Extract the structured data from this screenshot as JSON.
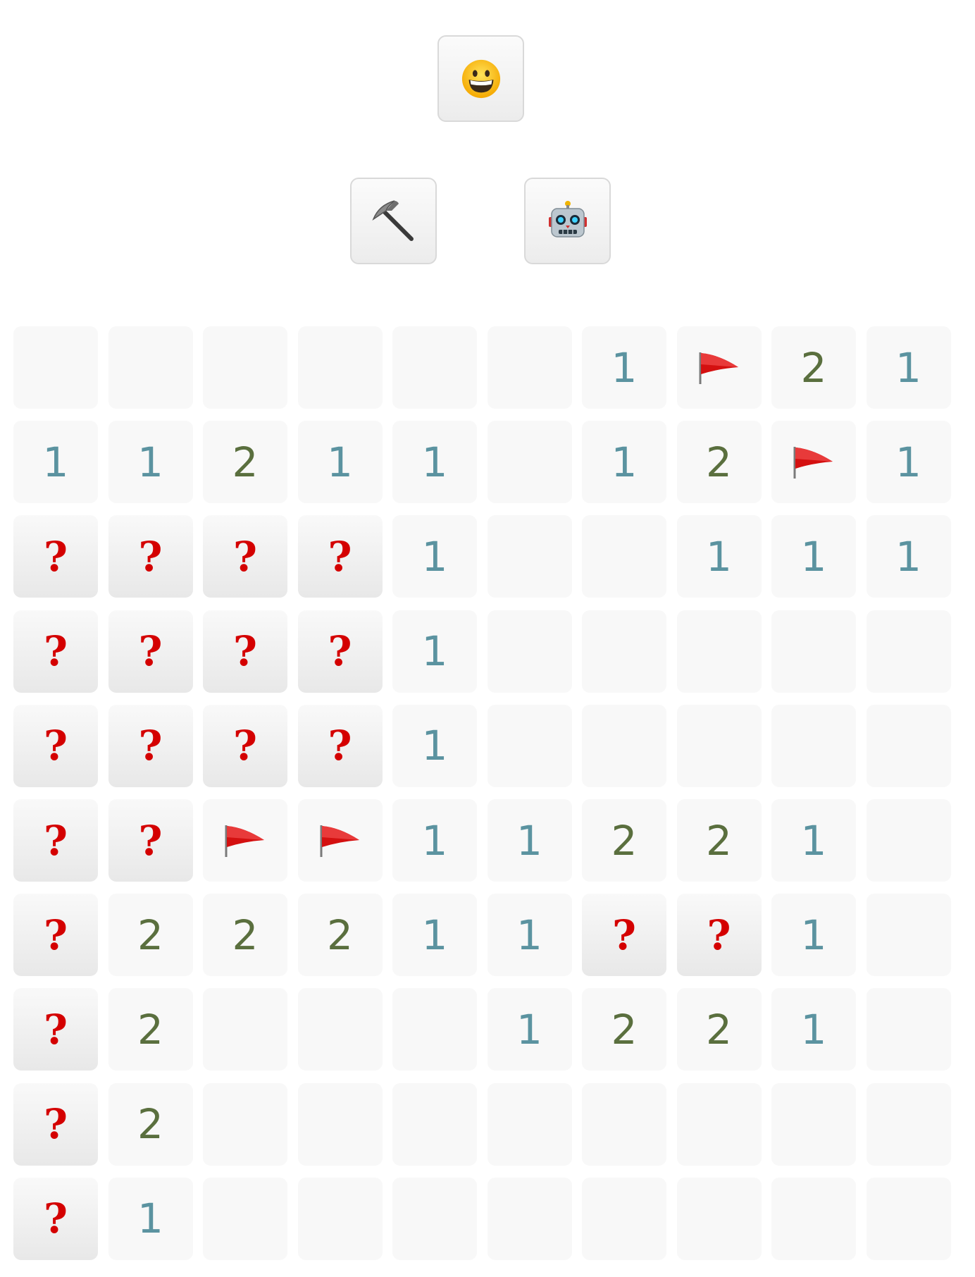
{
  "toolbar": {
    "face_icon": "grinning-face-icon",
    "dig_icon": "pickaxe-icon",
    "bot_icon": "robot-icon"
  },
  "colors": {
    "one": "#5b93a0",
    "two": "#5a6f3e",
    "question": "#d40000",
    "flag": "#d41010",
    "revealed_bg": "#f8f8f8"
  },
  "board": {
    "rows": 10,
    "cols": 10,
    "legend": {
      "E": "empty",
      "1": "one",
      "2": "two",
      "F": "flag",
      "Q": "unknown"
    },
    "grid": [
      [
        "E",
        "E",
        "E",
        "E",
        "E",
        "E",
        "1",
        "F",
        "2",
        "1"
      ],
      [
        "1",
        "1",
        "2",
        "1",
        "1",
        "E",
        "1",
        "2",
        "F",
        "1"
      ],
      [
        "Q",
        "Q",
        "Q",
        "Q",
        "1",
        "E",
        "E",
        "1",
        "1",
        "1"
      ],
      [
        "Q",
        "Q",
        "Q",
        "Q",
        "1",
        "E",
        "E",
        "E",
        "E",
        "E"
      ],
      [
        "Q",
        "Q",
        "Q",
        "Q",
        "1",
        "E",
        "E",
        "E",
        "E",
        "E"
      ],
      [
        "Q",
        "Q",
        "F",
        "F",
        "1",
        "1",
        "2",
        "2",
        "1",
        "E"
      ],
      [
        "Q",
        "2",
        "2",
        "2",
        "1",
        "1",
        "Q",
        "Q",
        "1",
        "E"
      ],
      [
        "Q",
        "2",
        "E",
        "E",
        "E",
        "1",
        "2",
        "2",
        "1",
        "E"
      ],
      [
        "Q",
        "2",
        "E",
        "E",
        "E",
        "E",
        "E",
        "E",
        "E",
        "E"
      ],
      [
        "Q",
        "1",
        "E",
        "E",
        "E",
        "E",
        "E",
        "E",
        "E",
        "E"
      ]
    ],
    "question_mark": "?"
  }
}
